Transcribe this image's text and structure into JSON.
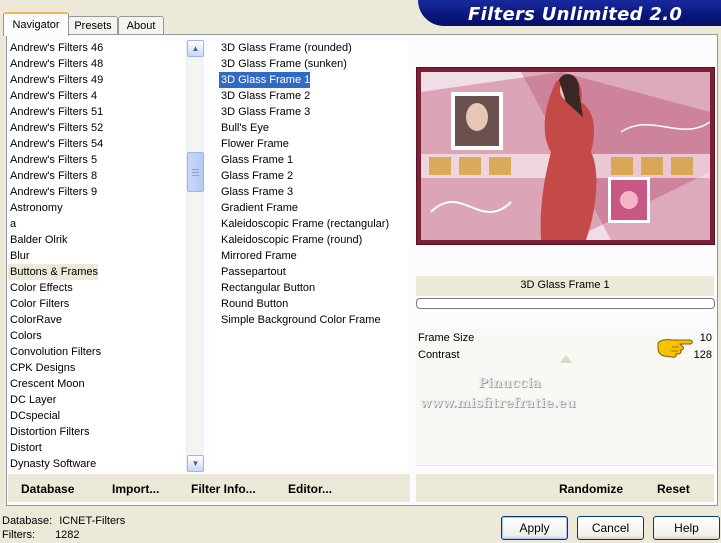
{
  "tabs": [
    "Navigator",
    "Presets",
    "About"
  ],
  "banner_title": "Filters Unlimited 2.0",
  "categories": [
    "Andrew's Filters 46",
    "Andrew's Filters 48",
    "Andrew's Filters 49",
    "Andrew's Filters 4",
    "Andrew's Filters 51",
    "Andrew's Filters 52",
    "Andrew's Filters 54",
    "Andrew's Filters 5",
    "Andrew's Filters 8",
    "Andrew's Filters 9",
    "Astronomy",
    "a",
    "Balder Olrik",
    "Blur",
    "Buttons & Frames",
    "Color Effects",
    "Color Filters",
    "ColorRave",
    "Colors",
    "Convolution Filters",
    "CPK Designs",
    "Crescent Moon",
    "DC Layer",
    "DCspecial",
    "Distortion Filters",
    "Distort",
    "Dynasty Software"
  ],
  "selected_category": "Buttons & Frames",
  "filters": [
    "3D Glass Frame (rounded)",
    "3D Glass Frame (sunken)",
    "3D Glass Frame 1",
    "3D Glass Frame 2",
    "3D Glass Frame 3",
    "Bull's Eye",
    "Flower Frame",
    "Glass Frame 1",
    "Glass Frame 2",
    "Glass Frame 3",
    "Gradient Frame",
    "Kaleidoscopic Frame (rectangular)",
    "Kaleidoscopic Frame (round)",
    "Mirrored Frame",
    "Passepartout",
    "Rectangular Button",
    "Round Button",
    "Simple Background Color Frame"
  ],
  "marked_filters": [
    "Flower Frame",
    "Gradient Frame",
    "Passepartout"
  ],
  "selected_filter": "3D Glass Frame 1",
  "filter_name_display": "3D Glass Frame 1",
  "params": [
    {
      "label": "Frame Size",
      "value": "10"
    },
    {
      "label": "Contrast",
      "value": "128"
    }
  ],
  "watermark_line1": "Pinuccia",
  "watermark_line2": "www.misfitrefratie.eu",
  "bar_left": {
    "database": "Database",
    "import": "Import...",
    "filter_info": "Filter Info...",
    "editor": "Editor..."
  },
  "bar_right": {
    "randomize": "Randomize",
    "reset": "Reset"
  },
  "status": {
    "database_label": "Database:",
    "database_value": "ICNET-Filters",
    "filters_label": "Filters:",
    "filters_value": "1282"
  },
  "buttons": {
    "apply": "Apply",
    "cancel": "Cancel",
    "help": "Help"
  },
  "colors": {
    "selection": "#316ac5",
    "banner": "#0b167a",
    "frame": "#7a2134",
    "pointer": "#f5c400"
  }
}
